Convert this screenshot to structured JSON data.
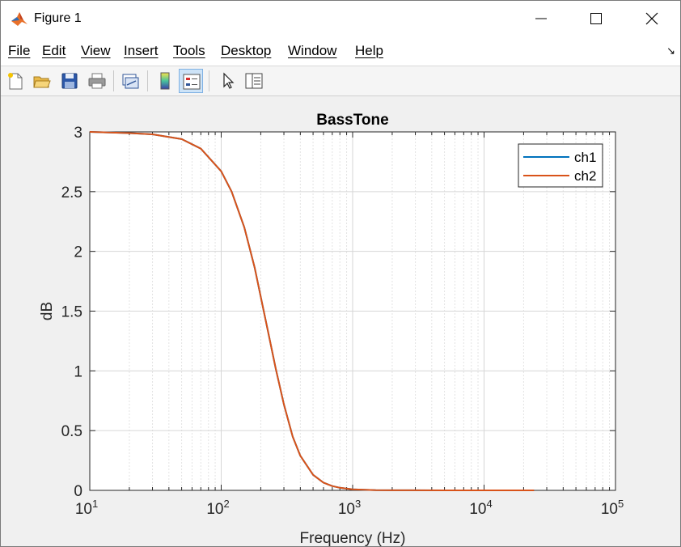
{
  "window": {
    "title": "Figure 1",
    "icon": "matlab-logo-icon"
  },
  "window_controls": [
    {
      "name": "minimize-button",
      "icon": "minimize-icon"
    },
    {
      "name": "maximize-button",
      "icon": "maximize-icon"
    },
    {
      "name": "close-button",
      "icon": "close-icon"
    }
  ],
  "menu": {
    "items": [
      "File",
      "Edit",
      "View",
      "Insert",
      "Tools",
      "Desktop",
      "Window",
      "Help"
    ],
    "dock_arrow": "↘"
  },
  "toolbar": {
    "buttons": [
      {
        "name": "new-figure-button",
        "icon": "new-file-icon"
      },
      {
        "name": "open-file-button",
        "icon": "open-folder-icon"
      },
      {
        "name": "save-figure-button",
        "icon": "save-icon"
      },
      {
        "name": "print-figure-button",
        "icon": "print-icon"
      },
      {
        "name": "link-plot-button",
        "icon": "link-plot-icon"
      },
      {
        "name": "insert-colorbar-button",
        "icon": "colorbar-icon"
      },
      {
        "name": "insert-legend-button",
        "icon": "legend-icon",
        "active": true
      },
      {
        "name": "edit-plot-button",
        "icon": "pointer-arrow-icon"
      },
      {
        "name": "property-inspector-button",
        "icon": "property-inspector-icon"
      }
    ]
  },
  "colors": {
    "ch1": "#0072BD",
    "ch2": "#D95319",
    "grid": "#e3e3e3",
    "axes": "#262626"
  },
  "chart_data": {
    "type": "line",
    "title": "BassTone",
    "xlabel": "Frequency (Hz)",
    "ylabel": "dB",
    "xscale": "log",
    "xlim": [
      10,
      100000
    ],
    "ylim": [
      0,
      3
    ],
    "xticks": [
      {
        "base": "10",
        "exp": "1"
      },
      {
        "base": "10",
        "exp": "2"
      },
      {
        "base": "10",
        "exp": "3"
      },
      {
        "base": "10",
        "exp": "4"
      },
      {
        "base": "10",
        "exp": "5"
      }
    ],
    "yticks": [
      "0",
      "0.5",
      "1",
      "1.5",
      "2",
      "2.5",
      "3"
    ],
    "grid": true,
    "minor_grid": true,
    "legend": {
      "position": "top-right",
      "entries": [
        "ch1",
        "ch2"
      ]
    },
    "series": [
      {
        "name": "ch1",
        "x": [
          10,
          20,
          30,
          50,
          70,
          100,
          120,
          150,
          180,
          200,
          230,
          260,
          300,
          350,
          400,
          500,
          600,
          700,
          800,
          1000,
          1500,
          2000,
          5000,
          10000,
          24000
        ],
        "y": [
          3.0,
          2.99,
          2.98,
          2.94,
          2.86,
          2.67,
          2.5,
          2.2,
          1.86,
          1.62,
          1.3,
          1.02,
          0.72,
          0.45,
          0.29,
          0.13,
          0.065,
          0.036,
          0.022,
          0.009,
          0.002,
          0.001,
          0,
          0,
          0
        ]
      },
      {
        "name": "ch2",
        "x": [
          10,
          20,
          30,
          50,
          70,
          100,
          120,
          150,
          180,
          200,
          230,
          260,
          300,
          350,
          400,
          500,
          600,
          700,
          800,
          1000,
          1500,
          2000,
          5000,
          10000,
          24000
        ],
        "y": [
          3.0,
          2.99,
          2.98,
          2.94,
          2.86,
          2.67,
          2.5,
          2.2,
          1.86,
          1.62,
          1.3,
          1.02,
          0.72,
          0.45,
          0.29,
          0.13,
          0.065,
          0.036,
          0.022,
          0.009,
          0.002,
          0.001,
          0,
          0,
          0
        ]
      }
    ]
  }
}
